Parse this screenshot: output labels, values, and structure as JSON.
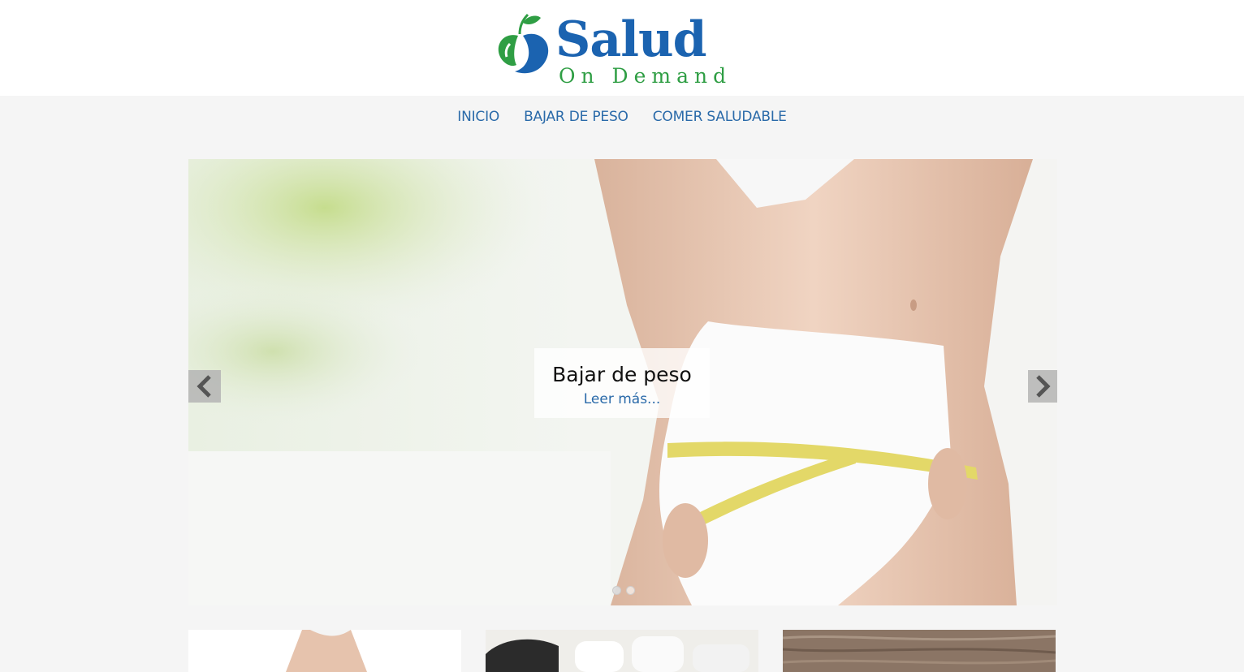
{
  "logo": {
    "word": "Salud",
    "sub": "On Demand",
    "colors": {
      "blue": "#1b63b0",
      "green": "#2f9e44"
    }
  },
  "nav": {
    "items": [
      {
        "label": "INICIO"
      },
      {
        "label": "BAJAR DE PESO"
      },
      {
        "label": "COMER SALUDABLE"
      }
    ],
    "color": "#2a6aa9"
  },
  "slider": {
    "caption_title": "Bajar de peso",
    "caption_link": "Leer más...",
    "prev_icon": "chevron-left-icon",
    "next_icon": "chevron-right-icon",
    "slide_count": 2,
    "active_slide": 1
  },
  "cards": [
    {
      "image": "waist-photo-thumbnail"
    },
    {
      "image": "supplement-jars-thumbnail"
    },
    {
      "image": "wood-texture-thumbnail"
    }
  ]
}
